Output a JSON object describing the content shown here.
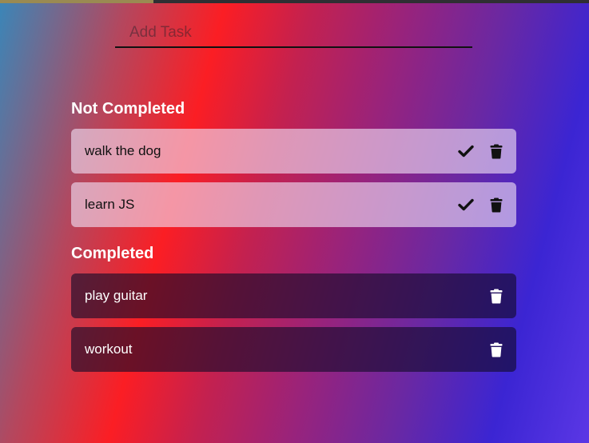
{
  "topbar": {
    "progress_fraction": 0.26
  },
  "add_task": {
    "placeholder": "Add Task",
    "value": ""
  },
  "sections": {
    "not_completed": {
      "heading": "Not Completed",
      "tasks": [
        {
          "label": "walk the dog"
        },
        {
          "label": "learn JS"
        }
      ]
    },
    "completed": {
      "heading": "Completed",
      "tasks": [
        {
          "label": "play guitar"
        },
        {
          "label": "workout"
        }
      ]
    }
  },
  "icons": {
    "complete": "check-icon",
    "delete": "trash-icon"
  },
  "colors": {
    "pending_icon": "#111111",
    "done_icon": "#ffffff"
  }
}
